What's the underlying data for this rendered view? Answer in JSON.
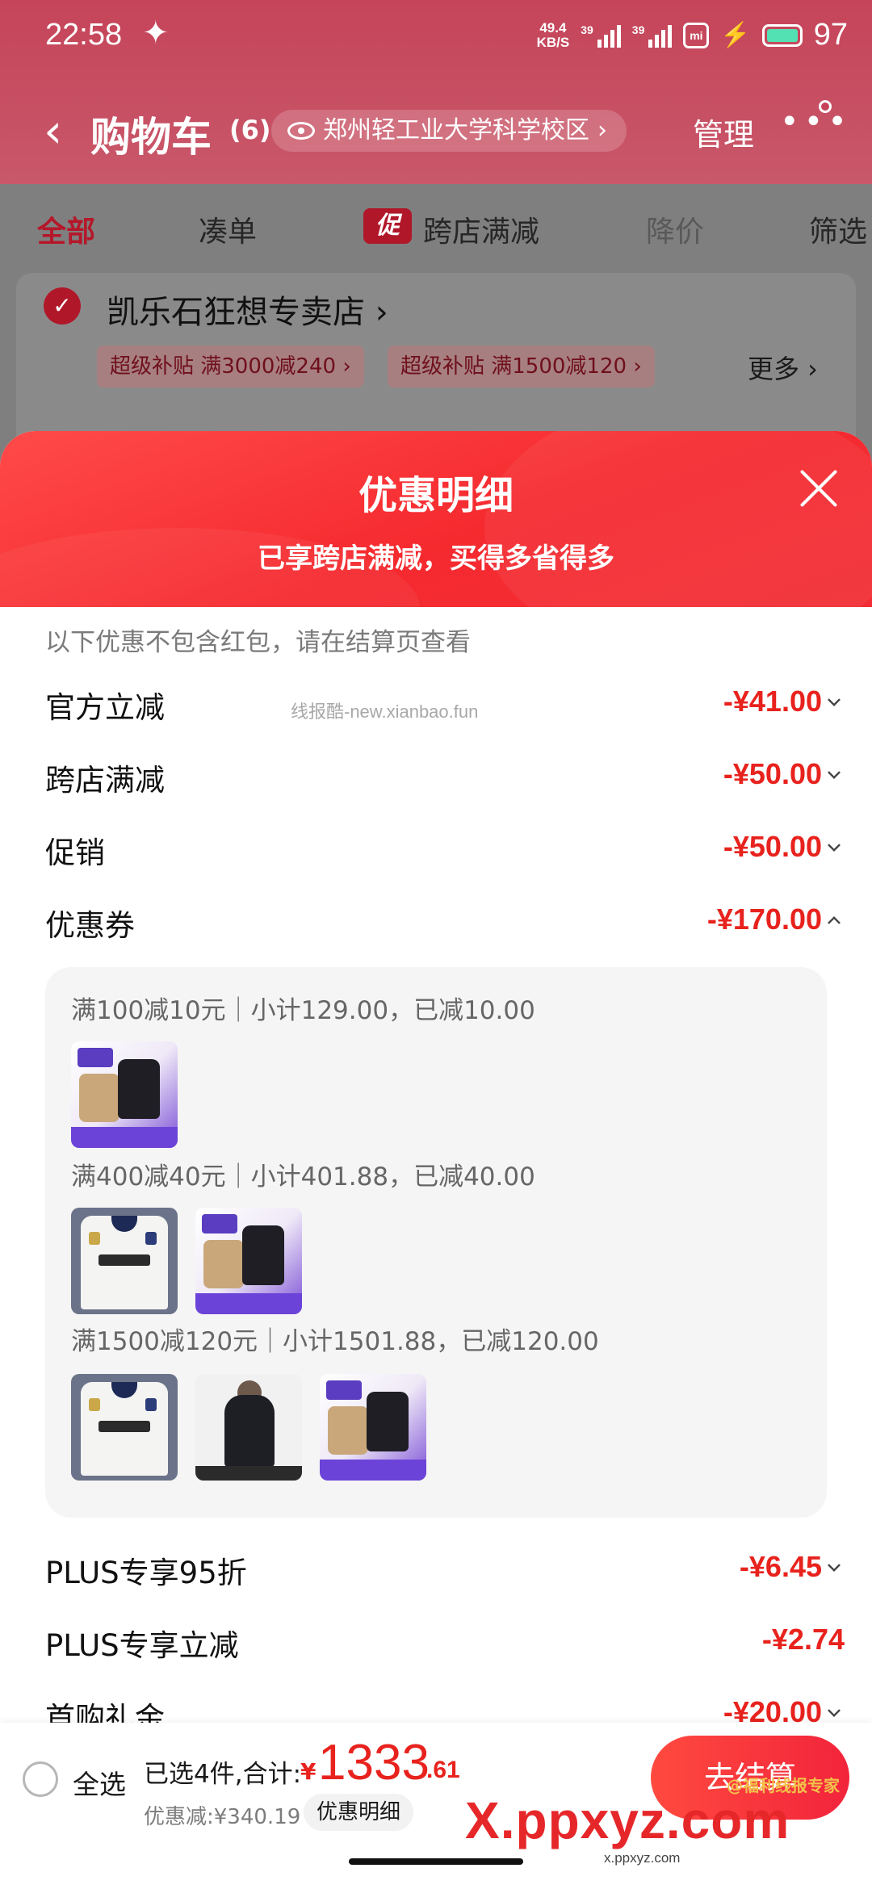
{
  "status_bar": {
    "time": "22:58",
    "net_speed_top": "49.4",
    "net_speed_bottom": "KB/S",
    "sim1": "39",
    "sim2": "39",
    "battery": "97"
  },
  "nav": {
    "title": "购物车",
    "count": "(6)",
    "address": "郑州轻工业大学科学校区",
    "address_chevron": "›",
    "manage": "管理",
    "more": "•••"
  },
  "tabs": [
    "全部",
    "凑单",
    "跨店满减",
    "降价",
    "筛选"
  ],
  "promo_badge": "促",
  "store": {
    "name": "凯乐石狂想专卖店",
    "chevron": "›",
    "chips": [
      "超级补贴  满3000减240 ›",
      "超级补贴  满1500减120 ›"
    ],
    "more": "更多 ›"
  },
  "sheet": {
    "title": "优惠明细",
    "subtitle": "已享跨店满减，买得多省得多",
    "note": "以下优惠不包含红包，请在结算页查看",
    "watermark": "线报酷-new.xianbao.fun",
    "rows": [
      {
        "label": "官方立减",
        "amount": "-¥41.00"
      },
      {
        "label": "跨店满减",
        "amount": "-¥50.00"
      },
      {
        "label": "促销",
        "amount": "-¥50.00"
      },
      {
        "label": "优惠券",
        "amount": "-¥170.00"
      }
    ],
    "coupons": [
      {
        "tier": "满100减10元｜小计129.00，已减10.00",
        "items": [
          "backpack"
        ]
      },
      {
        "tier": "满400减40元｜小计401.88，已减40.00",
        "items": [
          "jersey",
          "backpack"
        ]
      },
      {
        "tier": "满1500减120元｜小计1501.88，已减120.00",
        "items": [
          "jersey",
          "jacket",
          "backpack"
        ]
      }
    ],
    "rows_after": [
      {
        "label": "PLUS专享95折",
        "amount": "-¥6.45"
      },
      {
        "label": "PLUS专享立减",
        "amount": "-¥2.74"
      },
      {
        "label": "首购礼金",
        "amount": "-¥20.00"
      }
    ]
  },
  "bottom": {
    "select_all": "全选",
    "selected": "已选4件,合计:",
    "currency": "¥",
    "total_int": "1333",
    "total_dec": ".61",
    "savings": "优惠减:¥340.19",
    "detail_button": "优惠明细",
    "checkout": "去结算",
    "watermark_corner": "@福利线报专家",
    "watermark_big": "X.ppxyz.com",
    "watermark_small": "x.ppxyz.com"
  },
  "colors": {
    "accent_red": "#e8221d",
    "header_red": "#f52a2f",
    "store_red": "#b0182a"
  }
}
